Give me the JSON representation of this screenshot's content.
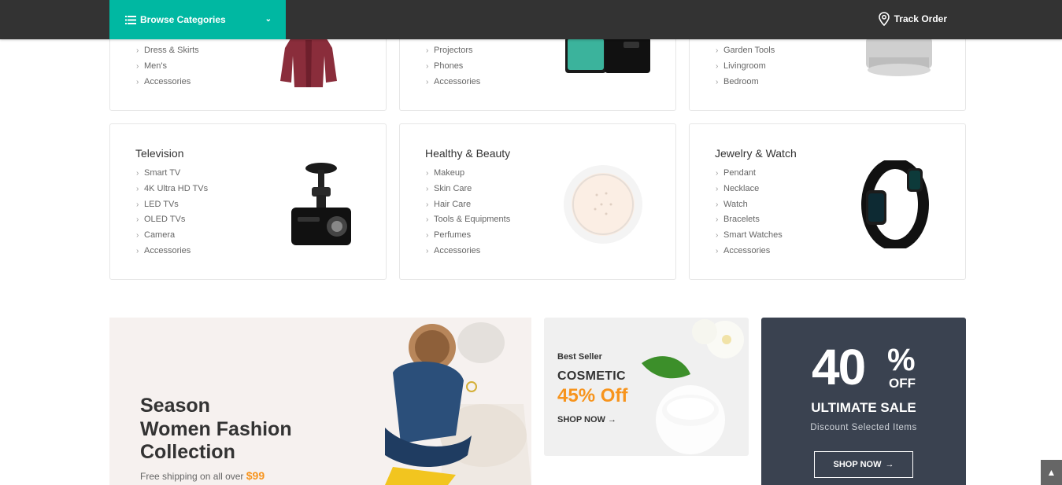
{
  "header": {
    "browse_label": "Browse Categories",
    "track_label": "Track Order"
  },
  "cards_top": [
    {
      "items": [
        "Dress & Skirts",
        "Men's",
        "Accessories"
      ]
    },
    {
      "items": [
        "Projectors",
        "Phones",
        "Accessories"
      ]
    },
    {
      "items": [
        "Garden Tools",
        "Livingroom",
        "Bedroom"
      ]
    }
  ],
  "cards": [
    {
      "title": "Television",
      "items": [
        "Smart TV",
        "4K Ultra HD TVs",
        "LED TVs",
        "OLED TVs",
        "Camera",
        "Accessories"
      ]
    },
    {
      "title": "Healthy & Beauty",
      "items": [
        "Makeup",
        "Skin Care",
        "Hair Care",
        "Tools & Equipments",
        "Perfumes",
        "Accessories"
      ]
    },
    {
      "title": "Jewelry & Watch",
      "items": [
        "Pendant",
        "Necklace",
        "Watch",
        "Bracelets",
        "Smart Watches",
        "Accessories"
      ]
    }
  ],
  "banner_fashion": {
    "line1": "Season",
    "line2": "Women Fashion",
    "line3": "Collection",
    "sub": "Free shipping on all over",
    "price": "$99"
  },
  "banner_cosmetic": {
    "eyebrow": "Best Seller",
    "title": "COSMETIC",
    "offer": "45% Off",
    "cta": "SHOP NOW"
  },
  "banner_sale": {
    "number": "40",
    "percent": "%",
    "off": "OFF",
    "title": "ULTIMATE SALE",
    "sub": "Discount Selected Items",
    "cta": "SHOP NOW"
  },
  "colors": {
    "accent": "#00b8a2",
    "topbar": "#333333",
    "orange": "#f7941d",
    "sale_bg": "#3a4250"
  }
}
